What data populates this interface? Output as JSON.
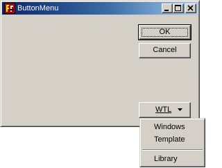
{
  "window": {
    "title": "ButtonMenu",
    "controls": {
      "minimize_icon": "minimize-icon",
      "maximize_icon": "maximize-icon",
      "close_icon": "close-icon"
    }
  },
  "buttons": {
    "ok_label": "OK",
    "cancel_label": "Cancel",
    "menu_button_label": "WTL",
    "menu_button_icon": "dropdown-arrow-icon"
  },
  "menu": {
    "items": [
      {
        "label": "Windows"
      },
      {
        "label": "Template"
      },
      {
        "label": "Library"
      }
    ]
  },
  "colors": {
    "face": "#d4d0c8",
    "title_start": "#0a246a",
    "title_end": "#a6caf0",
    "title_text": "#ffffff"
  }
}
